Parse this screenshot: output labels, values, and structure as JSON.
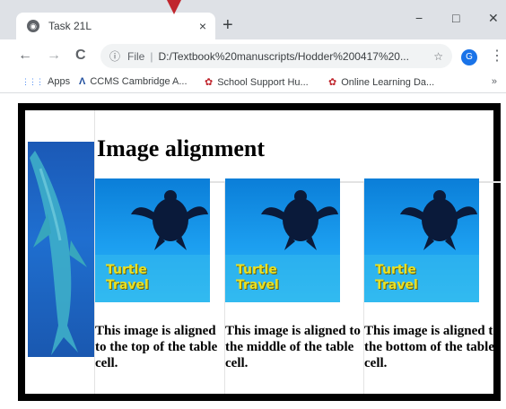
{
  "browser": {
    "tab_title": "Task 21L",
    "tab_close": "×",
    "new_tab": "+",
    "window": {
      "minimize": "−",
      "maximize": "□",
      "close": "✕"
    },
    "nav": {
      "back": "←",
      "forward": "→",
      "reload": "C"
    },
    "address": {
      "info_icon": "ⓘ",
      "scheme_label": "File",
      "separator": "|",
      "url": "D:/Textbook%20manuscripts/Hodder%200417%20...",
      "star": "☆"
    },
    "profile_initial": "G",
    "menu": "⋮",
    "bookmarks": [
      {
        "icon": "apps-grid-icon",
        "glyph": "⋮⋮⋮",
        "label": "Apps"
      },
      {
        "icon": "ccms-logo-icon",
        "glyph": "Λ",
        "label": "CCMS Cambridge A..."
      },
      {
        "icon": "school-support-icon",
        "glyph": "✿",
        "label": "School Support Hu..."
      },
      {
        "icon": "online-learning-icon",
        "glyph": "✿",
        "label": "Online Learning Da..."
      }
    ],
    "bookmarks_more": "»"
  },
  "page": {
    "heading": "Image alignment",
    "image_caption": [
      "Turtle",
      "Travel"
    ],
    "cells": [
      {
        "text": "This image is aligned to the top of the table cell."
      },
      {
        "text": "This image is aligned to the middle of the table cell."
      },
      {
        "text": "This image is aligned to the bottom of the table cell."
      }
    ]
  },
  "colors": {
    "accent_arrow": "#c0262d",
    "profile": "#1a73e8",
    "water_top": "#0b7ed8",
    "water_bottom": "#2cb5f2",
    "caption": "#e9e023"
  }
}
